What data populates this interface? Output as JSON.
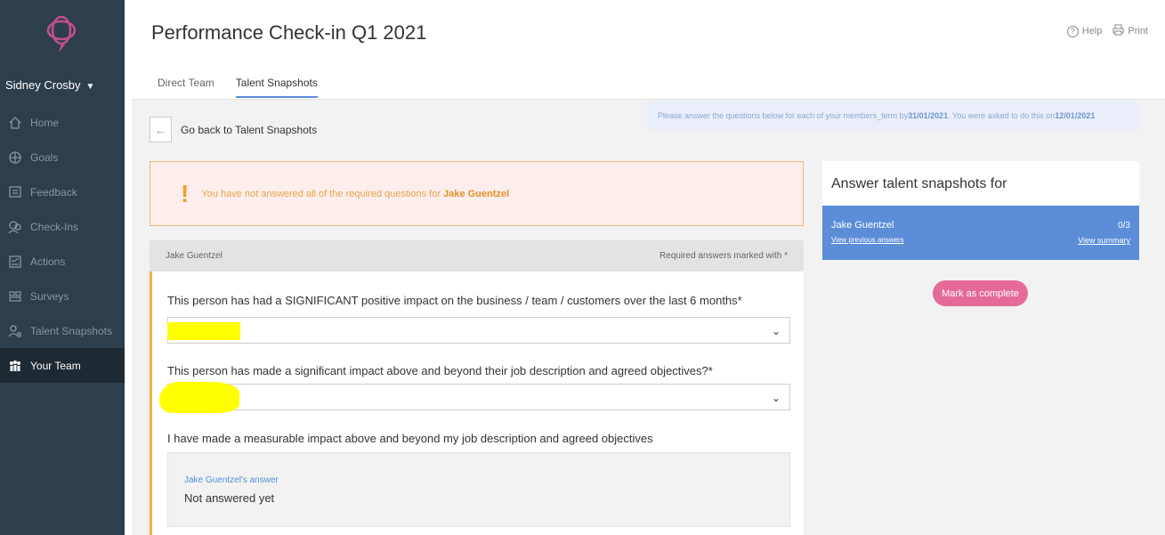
{
  "app": {
    "title": "Performance Check-in Q1 2021",
    "help_label": "Help",
    "print_label": "Print"
  },
  "sidebar": {
    "user": "Sidney Crosby",
    "items": [
      {
        "label": "Home",
        "icon": "home-icon"
      },
      {
        "label": "Goals",
        "icon": "target-icon"
      },
      {
        "label": "Feedback",
        "icon": "feedback-icon"
      },
      {
        "label": "Check-Ins",
        "icon": "check-ins-icon"
      },
      {
        "label": "Actions",
        "icon": "actions-icon"
      },
      {
        "label": "Surveys",
        "icon": "surveys-icon"
      },
      {
        "label": "Talent Snapshots",
        "icon": "talent-snapshots-icon"
      },
      {
        "label": "Your Team",
        "icon": "team-icon",
        "active": true
      }
    ]
  },
  "tabs": [
    {
      "label": "Direct Team"
    },
    {
      "label": "Talent Snapshots",
      "active": true
    }
  ],
  "back": {
    "label": "Go back to Talent Snapshots"
  },
  "info": {
    "prefix": "Please answer the questions below for each of your members_term by ",
    "due_date": "31/01/2021",
    "middle": ". You were asked to do this on ",
    "asked_date": "12/01/2021"
  },
  "warning": {
    "text": "You have not answered all of the required questions for ",
    "name": "Jake Guentzel"
  },
  "questions_header": {
    "person": "Jake Guentzel",
    "required_note": "Required answers marked with *"
  },
  "questions": [
    {
      "text": "This person has had a SIGNIFICANT positive impact on the business / team / customers over the last 6 months*",
      "value": ""
    },
    {
      "text": "This person has made a significant impact above and beyond their job description and agreed objectives?*",
      "value": ""
    },
    {
      "text": "I have made a measurable impact above and beyond my job description and agreed objectives"
    }
  ],
  "answer": {
    "label": "Jake Guentzel's answer",
    "value": "Not answered yet"
  },
  "right_panel": {
    "title": "Answer talent snapshots for",
    "person": "Jake Guentzel",
    "count": "0/3",
    "previous_link": "View previous answers",
    "summary_link": "View summary",
    "complete_button": "Mark as complete"
  },
  "colors": {
    "sidebar": "#2d3e4c",
    "accent": "#5b8dd9",
    "warning_bg": "#fdeeec",
    "pink": "#e56a98",
    "highlight": "#ffff00"
  }
}
